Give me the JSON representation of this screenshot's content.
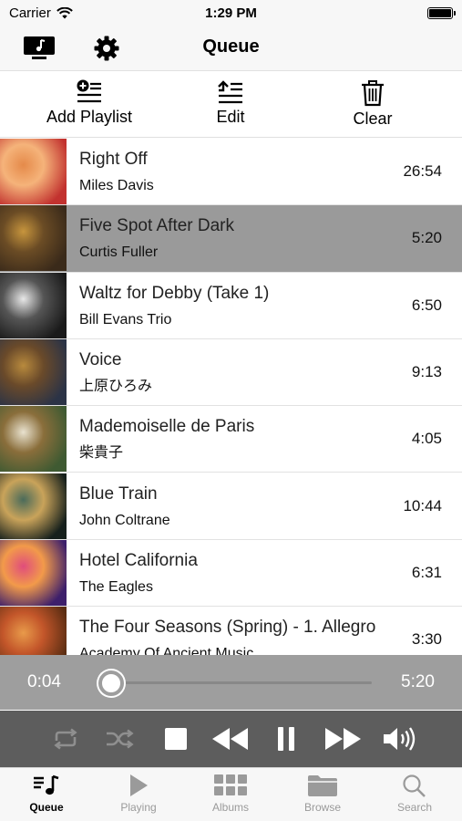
{
  "status_bar": {
    "carrier": "Carrier",
    "time": "1:29 PM"
  },
  "nav": {
    "title": "Queue",
    "left_icons": [
      "monitor-music-icon",
      "gear-icon"
    ]
  },
  "toolbar": {
    "add_playlist": "Add Playlist",
    "edit": "Edit",
    "clear": "Clear"
  },
  "queue": [
    {
      "title": "Right Off",
      "artist": "Miles Davis",
      "duration": "26:54",
      "selected": false,
      "thumb_colors": [
        "#c2322f",
        "#e58a4a",
        "#f5b37a"
      ]
    },
    {
      "title": "Five Spot After Dark",
      "artist": "Curtis Fuller",
      "duration": "5:20",
      "selected": true,
      "thumb_colors": [
        "#3a2a1a",
        "#c7953d",
        "#6b4c25"
      ]
    },
    {
      "title": "Waltz for Debby (Take 1)",
      "artist": "Bill Evans Trio",
      "duration": "6:50",
      "selected": false,
      "thumb_colors": [
        "#1a1a1a",
        "#e8e8e8",
        "#555555"
      ]
    },
    {
      "title": "Voice",
      "artist": "上原ひろみ",
      "duration": "9:13",
      "selected": false,
      "thumb_colors": [
        "#2b3346",
        "#b88a3d",
        "#6a4a2a"
      ]
    },
    {
      "title": "Mademoiselle de Paris",
      "artist": "柴貴子",
      "duration": "4:05",
      "selected": false,
      "thumb_colors": [
        "#3f5a32",
        "#e9e2cf",
        "#8a6e3b"
      ]
    },
    {
      "title": "Blue Train",
      "artist": "John Coltrane",
      "duration": "10:44",
      "selected": false,
      "thumb_colors": [
        "#16201c",
        "#4a6b5a",
        "#c9a35a"
      ]
    },
    {
      "title": "Hotel California",
      "artist": "The Eagles",
      "duration": "6:31",
      "selected": false,
      "thumb_colors": [
        "#3d1f6b",
        "#e04d7c",
        "#f29a4a"
      ]
    },
    {
      "title": "The Four Seasons (Spring) - 1. Allegro",
      "artist": "Academy Of Ancient Music",
      "duration": "3:30",
      "selected": false,
      "thumb_colors": [
        "#5a2d12",
        "#e89a4a",
        "#c3562a"
      ]
    }
  ],
  "player": {
    "elapsed": "0:04",
    "total": "5:20",
    "progress": 0.0125
  },
  "controls": [
    "repeat-icon",
    "shuffle-icon",
    "stop-icon",
    "rewind-icon",
    "pause-icon",
    "fast-forward-icon",
    "volume-icon"
  ],
  "tabs": [
    {
      "label": "Queue",
      "icon": "queue-music-icon",
      "active": true
    },
    {
      "label": "Playing",
      "icon": "play-icon",
      "active": false
    },
    {
      "label": "Albums",
      "icon": "grid-icon",
      "active": false
    },
    {
      "label": "Browse",
      "icon": "folder-icon",
      "active": false
    },
    {
      "label": "Search",
      "icon": "search-icon",
      "active": false
    }
  ],
  "colors": {
    "selected_row": "#9a9a9a",
    "progress_bg": "#9e9e9e",
    "controls_bg": "#5d5d5d",
    "tab_inactive": "#9a9a9a"
  }
}
